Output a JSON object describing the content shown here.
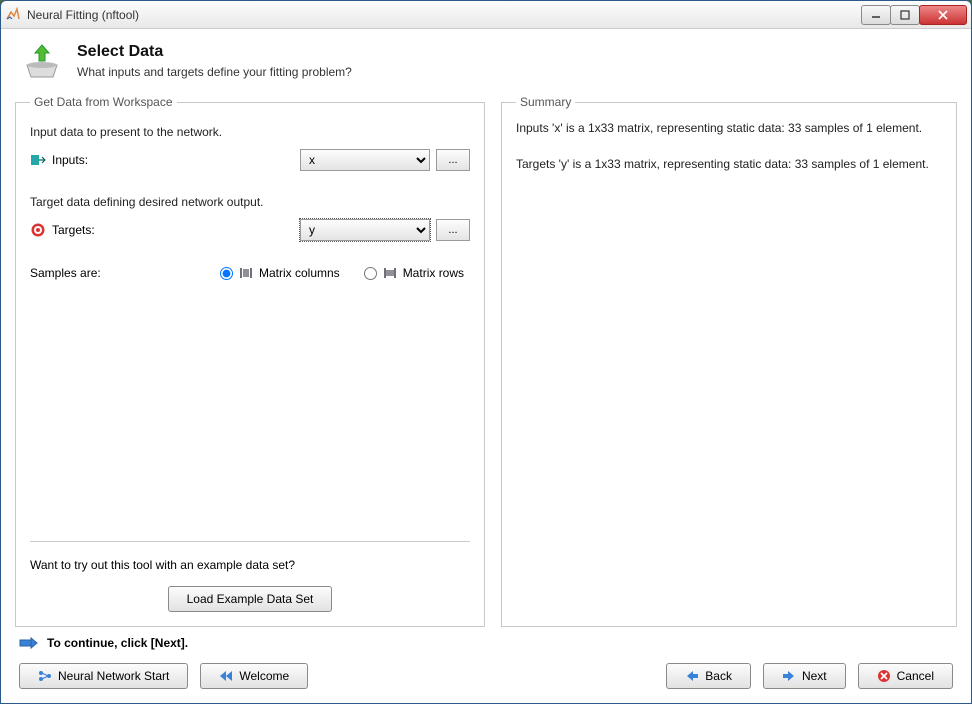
{
  "window": {
    "title": "Neural Fitting (nftool)"
  },
  "header": {
    "title": "Select Data",
    "subtitle": "What inputs and targets define your fitting problem?"
  },
  "getData": {
    "legend": "Get Data from Workspace",
    "inputDesc": "Input data to present to the network.",
    "inputsLabel": "Inputs:",
    "inputsValue": "x",
    "targetDesc": "Target data defining desired network output.",
    "targetsLabel": "Targets:",
    "targetsValue": "y",
    "samplesLabel": "Samples are:",
    "radioColumns": "Matrix columns",
    "radioRows": "Matrix rows",
    "browse": "...",
    "exampleText": "Want to try out this tool with an example data set?",
    "loadExample": "Load Example Data Set"
  },
  "summary": {
    "legend": "Summary",
    "inputsText": "Inputs 'x' is a 1x33 matrix, representing static data: 33 samples of 1 element.",
    "targetsText": "Targets 'y' is a 1x33 matrix, representing static data: 33 samples of 1 element."
  },
  "footer": {
    "hint": "To continue, click [Next].",
    "neuralStart": "Neural Network Start",
    "welcome": "Welcome",
    "back": "Back",
    "next": "Next",
    "cancel": "Cancel"
  }
}
